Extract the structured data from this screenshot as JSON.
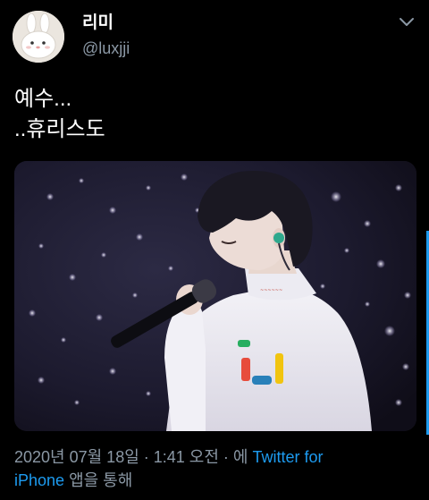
{
  "user": {
    "display_name": "리미",
    "handle": "@luxjji",
    "avatar_icon": "bunny-avatar-icon"
  },
  "tweet": {
    "lines": [
      "예수...",
      "..휴리스도"
    ]
  },
  "media": {
    "description_icon": "concert-photo",
    "watermark": ""
  },
  "meta": {
    "timestamp": "2020년 07월 18일 · 1:41 오전 · ",
    "via_prefix": "에 ",
    "source_part1": "Twitter for",
    "source_part2": "iPhone",
    "via_suffix": " 앱을 통해"
  },
  "colors": {
    "link": "#1d9bf0",
    "secondary_text": "#8b98a5",
    "background": "#000000"
  }
}
